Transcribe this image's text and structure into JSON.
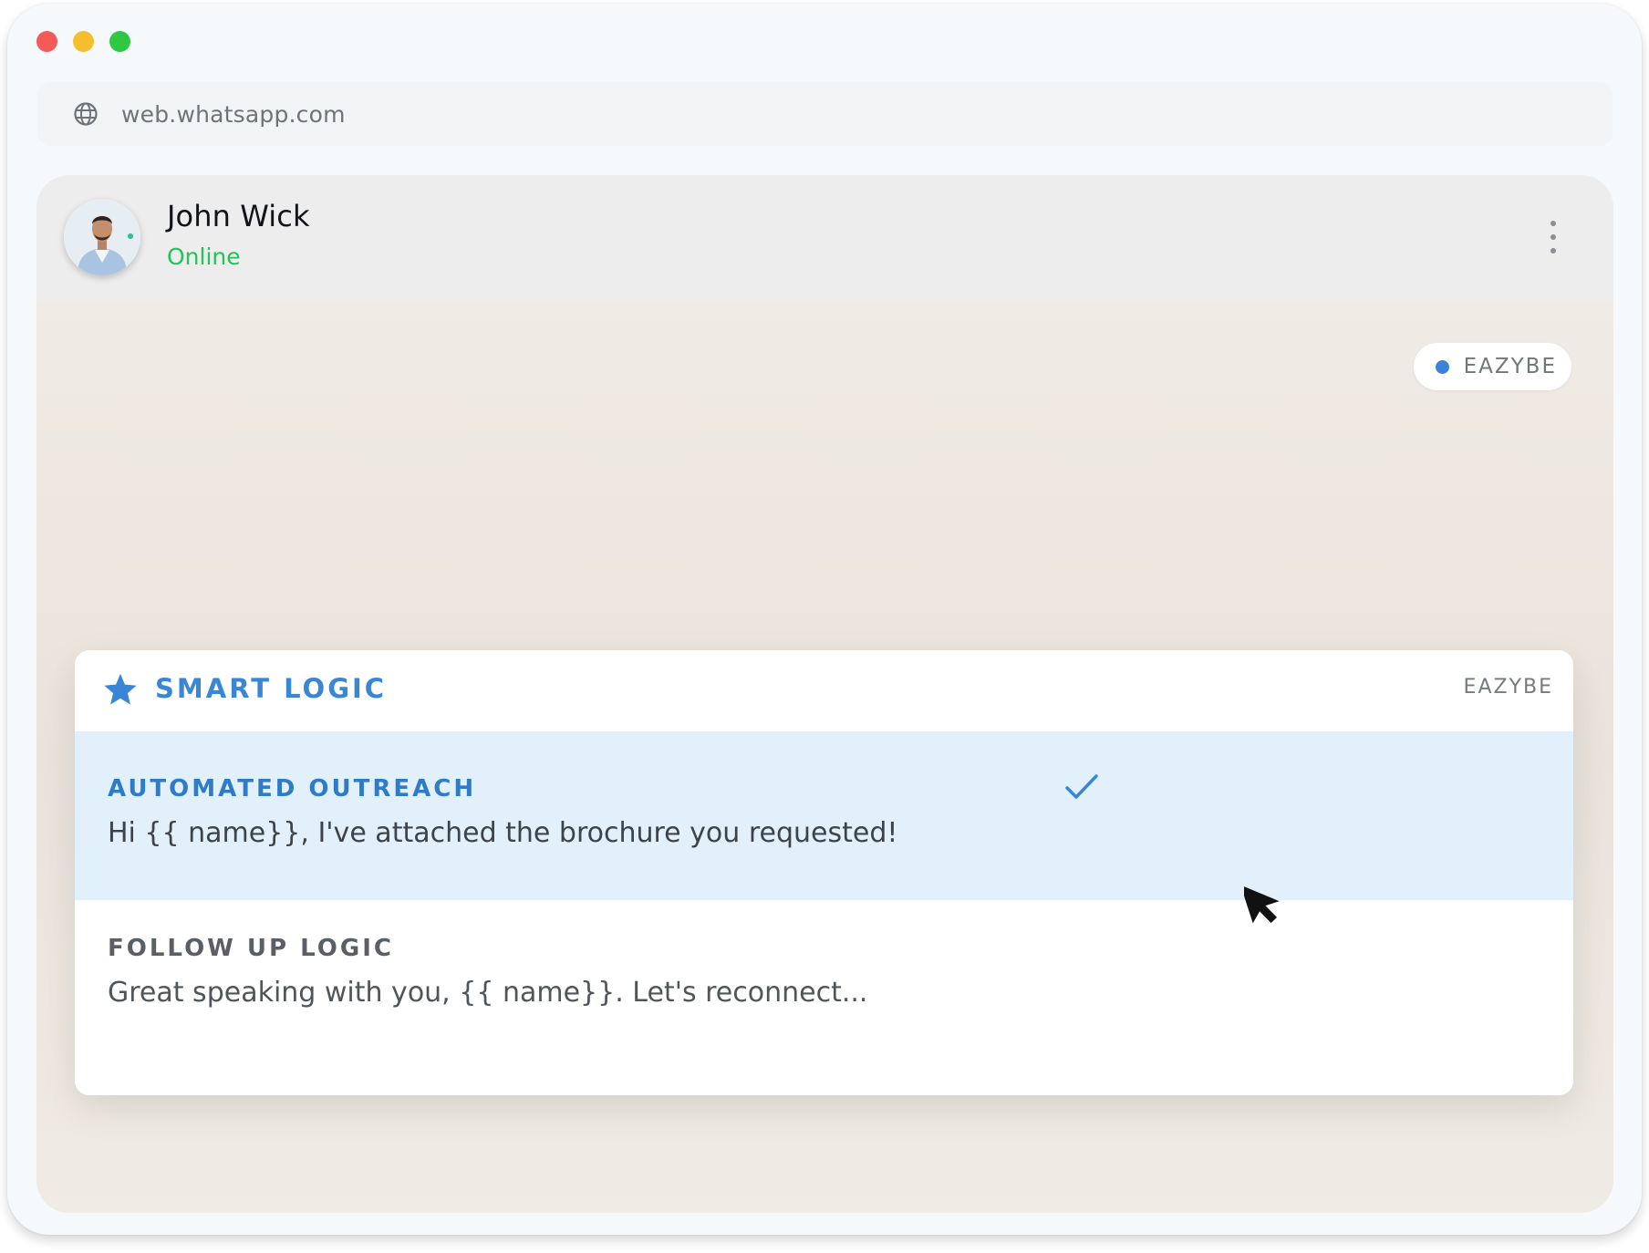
{
  "browser": {
    "url": "web.whatsapp.com",
    "traffic_lights": [
      {
        "name": "close",
        "color": "#f25b56"
      },
      {
        "name": "minimize",
        "color": "#f5be2f"
      },
      {
        "name": "maximize",
        "color": "#2fc841"
      }
    ]
  },
  "chat": {
    "contact_name": "John Wick",
    "status": "Online",
    "status_color": "#21c45a",
    "extension_badge": "EAZYBE"
  },
  "smart_logic": {
    "title": "SMART LOGIC",
    "brand": "EAZYBE",
    "accent_color": "#3a86d6",
    "options": [
      {
        "title": "AUTOMATED OUTREACH",
        "text": "Hi {{ name}}, I've attached the brochure you requested!",
        "selected": true
      },
      {
        "title": "FOLLOW UP LOGIC",
        "text": "Great speaking with you, {{ name}}. Let's reconnect...",
        "selected": false
      }
    ]
  }
}
